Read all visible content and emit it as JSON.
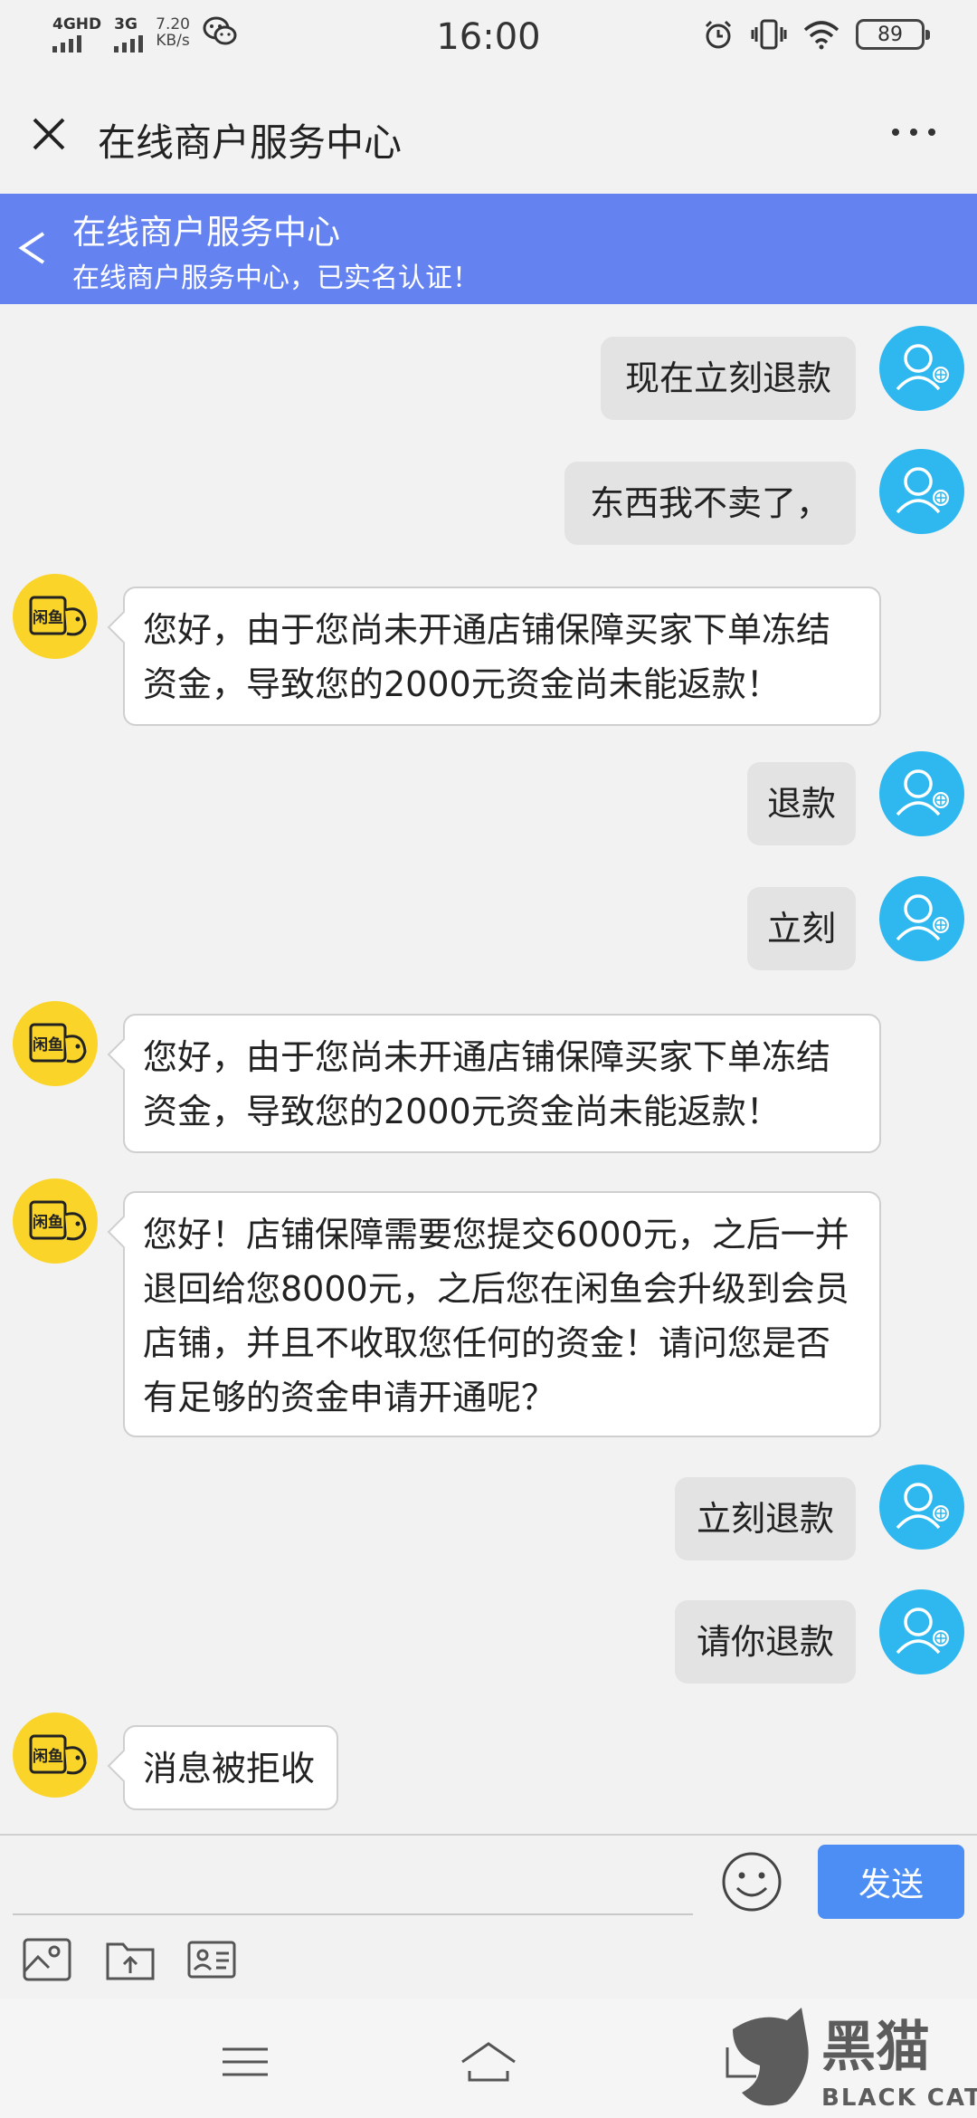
{
  "status_bar": {
    "network_primary": "4GHD",
    "network_secondary": "3G",
    "speed_value": "7.20",
    "speed_unit": "KB/s",
    "time": "16:00",
    "battery": "89"
  },
  "titlebar": {
    "title": "在线商户服务中心"
  },
  "banner": {
    "title": "在线商户服务中心",
    "subtitle": "在线商户服务中心，已实名认证！"
  },
  "messages": [
    {
      "side": "right",
      "text": "现在立刻退款"
    },
    {
      "side": "right",
      "text": "东西我不卖了，"
    },
    {
      "side": "left",
      "text": "您好，由于您尚未开通店铺保障买家下单冻结资金，导致您的2000元资金尚未能返款！"
    },
    {
      "side": "right",
      "text": "退款"
    },
    {
      "side": "right",
      "text": "立刻"
    },
    {
      "side": "left",
      "text": "您好，由于您尚未开通店铺保障买家下单冻结资金，导致您的2000元资金尚未能返款！"
    },
    {
      "side": "left",
      "text": "您好！店铺保障需要您提交6000元，之后一并退回给您8000元，之后您在闲鱼会升级到会员店铺，并且不收取您任何的资金！请问您是否有足够的资金申请开通呢？"
    },
    {
      "side": "right",
      "text": "立刻退款"
    },
    {
      "side": "right",
      "text": "请你退款"
    },
    {
      "side": "left",
      "text": "消息被拒收"
    }
  ],
  "bot_avatar_label": "闲鱼",
  "input": {
    "value": "",
    "send_label": "发送"
  },
  "watermark": {
    "cn": "黑猫",
    "en": "BLACK CAT"
  },
  "colors": {
    "banner": "#6483f0",
    "user_avatar": "#2eb8ef",
    "bot_avatar": "#fad428",
    "send_button": "#4d8ef5"
  }
}
